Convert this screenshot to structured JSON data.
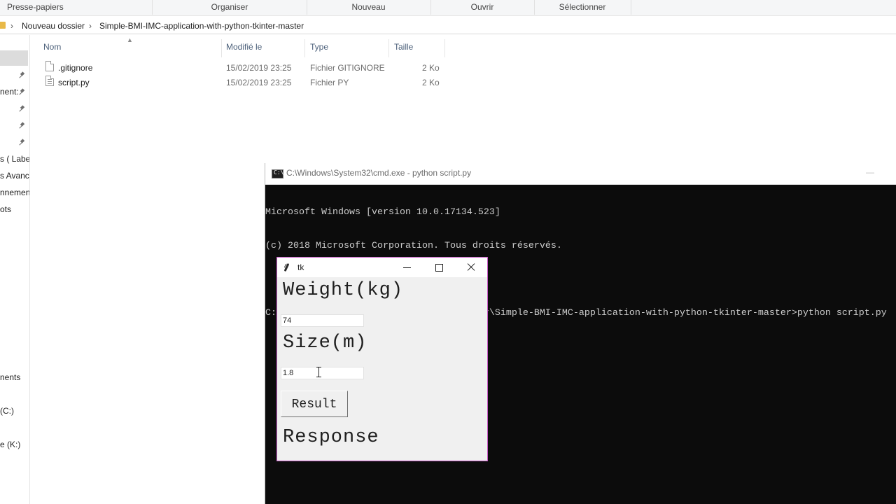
{
  "ribbon": {
    "groups": [
      "Presse-papiers",
      "Organiser",
      "Nouveau",
      "Ouvrir",
      "Sélectionner"
    ]
  },
  "address": {
    "crumbs": [
      "Nouveau dossier",
      "Simple-BMI-IMC-application-with-python-tkinter-master"
    ]
  },
  "nav": {
    "items": [
      "nent:",
      "s ( Label",
      "s Avanc",
      "nnemen",
      "ots",
      "nents",
      "(C:)",
      "e (K:)"
    ]
  },
  "file_list": {
    "columns": [
      "Nom",
      "Modifié le",
      "Type",
      "Taille"
    ],
    "rows": [
      {
        "name": ".gitignore",
        "modified": "15/02/2019 23:25",
        "type": "Fichier GITIGNORE",
        "size": "2 Ko"
      },
      {
        "name": "script.py",
        "modified": "15/02/2019 23:25",
        "type": "Fichier PY",
        "size": "2 Ko"
      }
    ]
  },
  "cmd": {
    "title": "C:\\Windows\\System32\\cmd.exe - python  script.py",
    "minimize_glyph": "—",
    "lines": [
      "Microsoft Windows [version 10.0.17134.523]",
      "(c) 2018 Microsoft Corporation. Tous droits réservés.",
      "",
      "C:\\Users\\HP Z400\\Desktop\\Nouveau dossier\\Simple-BMI-IMC-application-with-python-tkinter-master>python script.py"
    ]
  },
  "tk": {
    "title": "tk",
    "weight_label": "Weight(kg)",
    "weight_value": "74",
    "size_label": "Size(m)",
    "size_value": "1.8",
    "result_button": "Result",
    "response_label": "Response"
  }
}
